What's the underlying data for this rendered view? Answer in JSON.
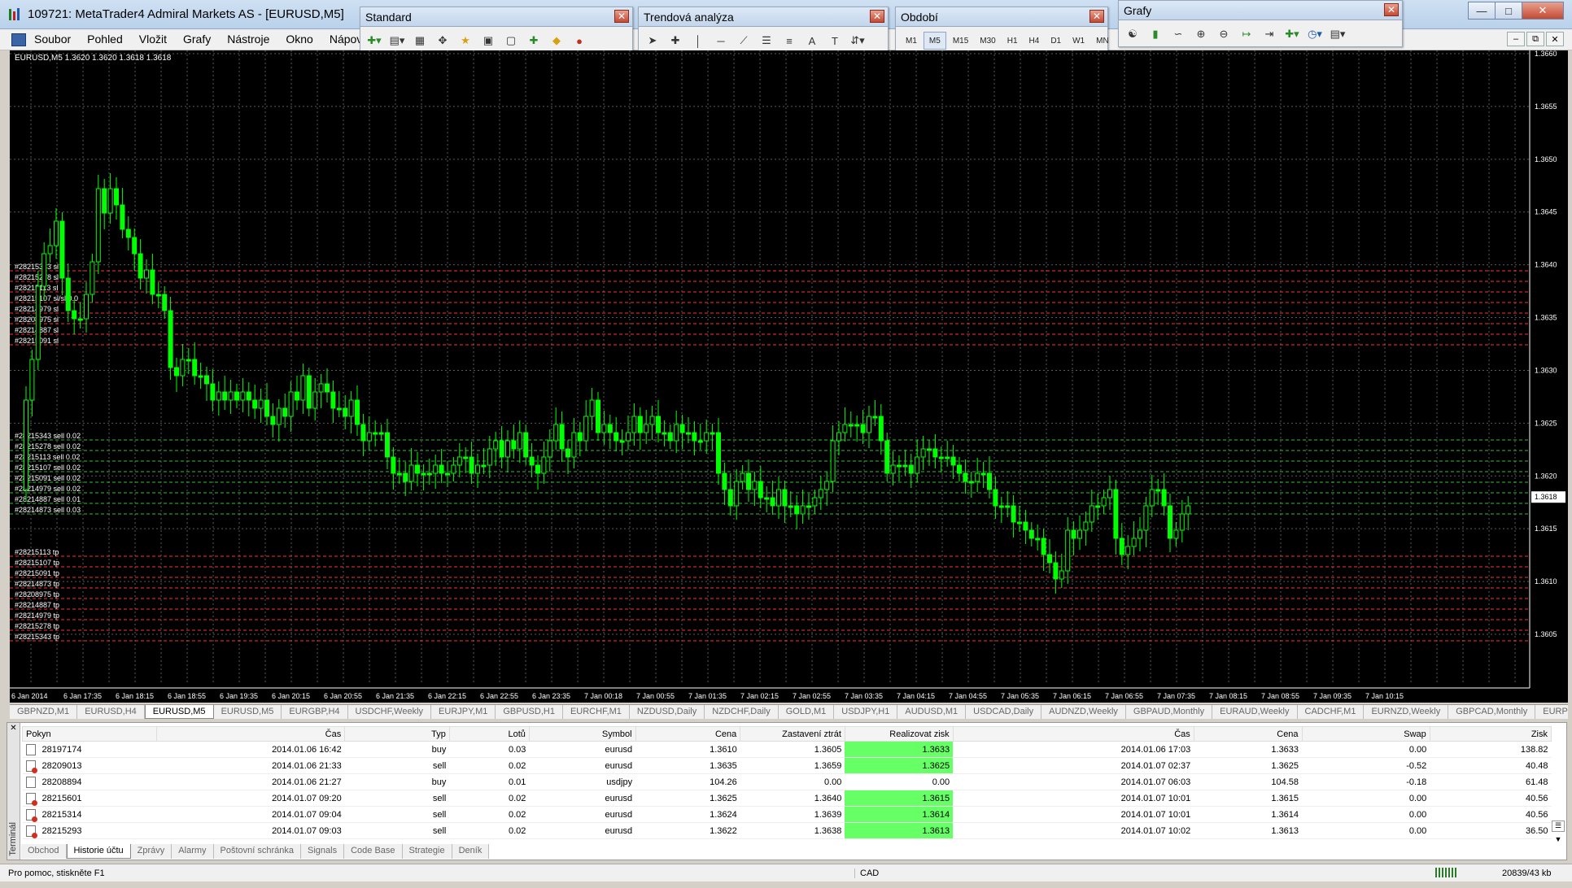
{
  "window": {
    "title": "109721: MetaTrader4 Admiral Markets AS - [EURUSD,M5]"
  },
  "menu": [
    "Soubor",
    "Pohled",
    "Vložit",
    "Grafy",
    "Nástroje",
    "Okno",
    "Nápove"
  ],
  "toolbars": {
    "standard": {
      "title": "Standard"
    },
    "trend": {
      "title": "Trendová analýza"
    },
    "period": {
      "title": "Období",
      "periods": [
        "M1",
        "M5",
        "M15",
        "M30",
        "H1",
        "H4",
        "D1",
        "W1",
        "MN"
      ],
      "active": "M5"
    },
    "charts": {
      "title": "Grafy"
    }
  },
  "chart": {
    "header": "EURUSD,M5  1.3620 1.3620 1.3618 1.3618",
    "current_price": "1.3618",
    "price_labels": [
      "1.3660",
      "1.3655",
      "1.3650",
      "1.3645",
      "1.3640",
      "1.3635",
      "1.3630",
      "1.3625",
      "1.3620",
      "1.3615",
      "1.3610",
      "1.3605"
    ],
    "time_labels": [
      "6 Jan 2014",
      "6 Jan 17:35",
      "6 Jan 18:15",
      "6 Jan 18:55",
      "6 Jan 19:35",
      "6 Jan 20:15",
      "6 Jan 20:55",
      "6 Jan 21:35",
      "6 Jan 22:15",
      "6 Jan 22:55",
      "6 Jan 23:35",
      "7 Jan 00:18",
      "7 Jan 00:55",
      "7 Jan 01:35",
      "7 Jan 02:15",
      "7 Jan 02:55",
      "7 Jan 03:35",
      "7 Jan 04:15",
      "7 Jan 04:55",
      "7 Jan 05:35",
      "7 Jan 06:15",
      "7 Jan 06:55",
      "7 Jan 07:35",
      "7 Jan 08:15",
      "7 Jan 08:55",
      "7 Jan 09:35",
      "7 Jan 10:15"
    ],
    "sl_labels": [
      "#28215343 sl",
      "#28215278 sl",
      "#28215113 sl",
      "#28215107 sl/sl 0.0",
      "#28214979 sl",
      "#28208975 sl",
      "#28214887 sl",
      "#28215091 sl"
    ],
    "order_labels": [
      "#28215343 sell 0.02",
      "#28215278 sell 0.02",
      "#28215113 sell 0.02",
      "#28215107 sell 0.02",
      "#28215091 sell 0.02",
      "#28214979 sell 0.02",
      "#28214887 sell 0.01",
      "#28214873 sell 0.03"
    ],
    "tp_labels": [
      "#28215113 tp",
      "#28215107 tp",
      "#28215091 tp",
      "#28214873 tp",
      "#28208975 tp",
      "#28214887 tp",
      "#28214979 tp",
      "#28215278 tp",
      "#28215343 tp"
    ],
    "colors": {
      "bull": "#00ff00",
      "sl": "#ff3030",
      "order": "#30c030",
      "grid": "#5a5a5a"
    }
  },
  "symbol_tabs": [
    "GBPNZD,M1",
    "EURUSD,H4",
    "EURUSD,M5",
    "EURUSD,M5",
    "EURGBP,H4",
    "USDCHF,Weekly",
    "EURJPY,M1",
    "GBPUSD,H1",
    "EURCHF,M1",
    "NZDUSD,Daily",
    "NZDCHF,Daily",
    "GOLD,M1",
    "USDJPY,H1",
    "AUDUSD,M1",
    "USDCAD,Daily",
    "AUDNZD,Weekly",
    "GBPAUD,Monthly",
    "EURAUD,Weekly",
    "CADCHF,M1",
    "EURNZD,Weekly",
    "GBPCAD,Monthly",
    "EURPLN,"
  ],
  "active_symbol_tab": 2,
  "history": {
    "columns": [
      "Pokyn",
      "Čas",
      "Typ",
      "Lotů",
      "Symbol",
      "Cena",
      "Zastavení ztrát",
      "Realizovat zisk",
      "Čas",
      "Cena",
      "Swap",
      "Zisk"
    ],
    "rows": [
      [
        "28197174",
        "2014.01.06 16:42",
        "buy",
        "0.03",
        "eurusd",
        "1.3610",
        "1.3605",
        "1.3633",
        "2014.01.06 17:03",
        "1.3633",
        "0.00",
        "138.82"
      ],
      [
        "28209013",
        "2014.01.06 21:33",
        "sell",
        "0.02",
        "eurusd",
        "1.3635",
        "1.3659",
        "1.3625",
        "2014.01.07 02:37",
        "1.3625",
        "-0.52",
        "40.48"
      ],
      [
        "28208894",
        "2014.01.06 21:27",
        "buy",
        "0.01",
        "usdjpy",
        "104.26",
        "0.00",
        "0.00",
        "2014.01.07 06:03",
        "104.58",
        "-0.18",
        "61.48"
      ],
      [
        "28215601",
        "2014.01.07 09:20",
        "sell",
        "0.02",
        "eurusd",
        "1.3625",
        "1.3640",
        "1.3615",
        "2014.01.07 10:01",
        "1.3615",
        "0.00",
        "40.56"
      ],
      [
        "28215314",
        "2014.01.07 09:04",
        "sell",
        "0.02",
        "eurusd",
        "1.3624",
        "1.3639",
        "1.3614",
        "2014.01.07 10:01",
        "1.3614",
        "0.00",
        "40.56"
      ],
      [
        "28215293",
        "2014.01.07 09:03",
        "sell",
        "0.02",
        "eurusd",
        "1.3622",
        "1.3638",
        "1.3613",
        "2014.01.07 10:02",
        "1.3613",
        "0.00",
        "36.50"
      ]
    ],
    "tp_highlight_color": "#66ff66"
  },
  "terminal": {
    "side_label": "Terminál",
    "tabs": [
      "Obchod",
      "Historie účtu",
      "Zprávy",
      "Alarmy",
      "Poštovní schránka",
      "Signals",
      "Code Base",
      "Strategie",
      "Deník"
    ],
    "active_tab": 1
  },
  "status": {
    "help": "Pro pomoc, stiskněte F1",
    "profile": "CAD",
    "traffic": "20839/43 kb"
  }
}
